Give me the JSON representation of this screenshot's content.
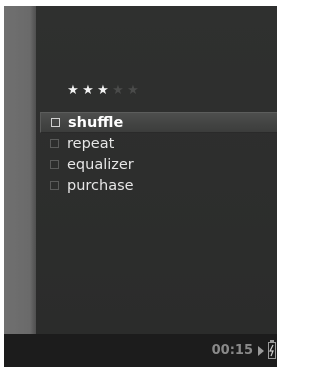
{
  "rating": {
    "value": 3,
    "max": 5
  },
  "menu": {
    "items": [
      {
        "label": "shuffle",
        "selected": true
      },
      {
        "label": "repeat",
        "selected": false
      },
      {
        "label": "equalizer",
        "selected": false
      },
      {
        "label": "purchase",
        "selected": false
      }
    ]
  },
  "status": {
    "time": "00:15",
    "play_icon": "play-icon",
    "battery_icon": "battery-charging-icon"
  }
}
